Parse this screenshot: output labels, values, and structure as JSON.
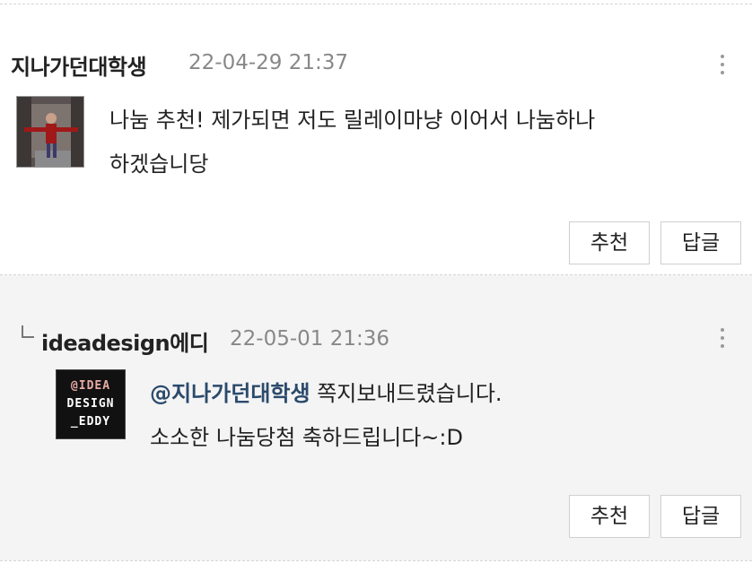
{
  "comments": [
    {
      "author": "지나가던대학생",
      "date": "22-04-29 21:37",
      "text_line1": "나눔 추천! 제가되면 저도 릴레이마냥 이어서 나눔하나",
      "text_line2": "하겠습니당",
      "recommend_label": "추천",
      "reply_label": "답글"
    },
    {
      "author": "ideadesign에디",
      "date": "22-05-01 21:36",
      "mention": "@지나가던대학생",
      "text_line1_rest": " 쪽지보내드렸습니다.",
      "text_line2": "소소한 나눔당첨 축하드립니다~:D",
      "avatar_text": [
        "@IDEA",
        "DESIGN",
        "_EDDY"
      ],
      "recommend_label": "추천",
      "reply_label": "답글"
    }
  ],
  "icons": {
    "more": "more-vertical-icon",
    "reply_indent": "reply-arrow-icon"
  },
  "colors": {
    "reply_background": "#f4f4f5",
    "mention": "#2b4a6b",
    "date": "#888888"
  }
}
